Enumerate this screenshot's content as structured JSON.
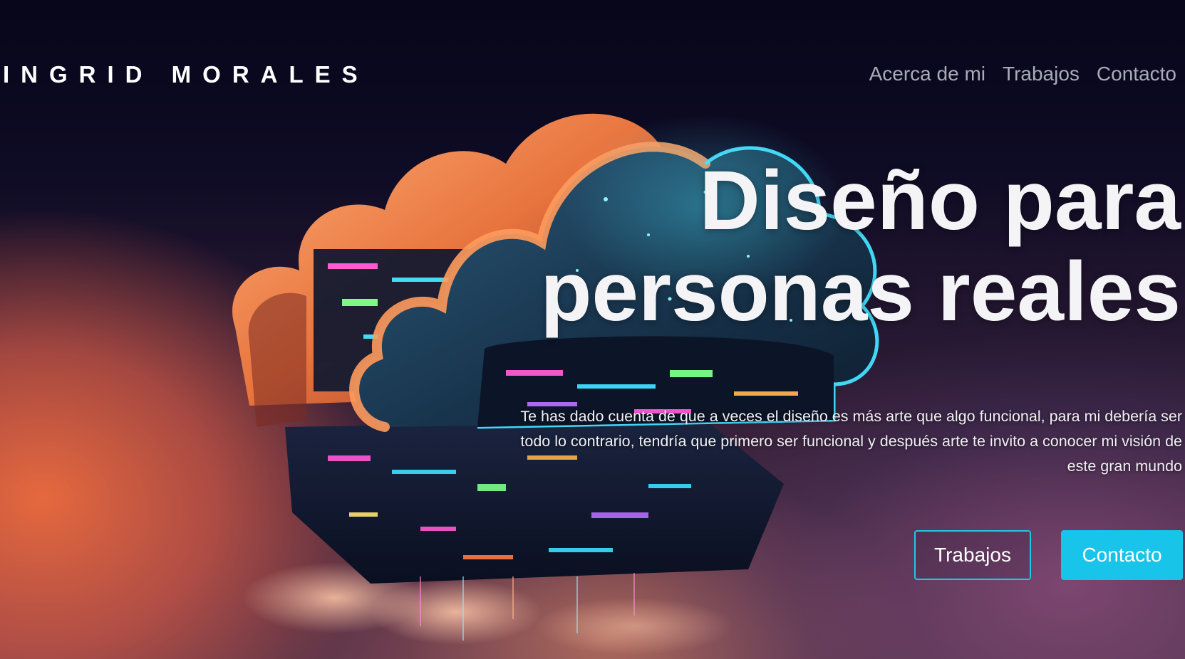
{
  "header": {
    "brand": "INGRID MORALES",
    "nav": [
      {
        "label": "Acerca de mi"
      },
      {
        "label": "Trabajos"
      },
      {
        "label": "Contacto"
      }
    ]
  },
  "hero": {
    "title_line1": "Diseño para",
    "title_line2": "personas reales",
    "description": "Te has dado cuenta de que a veces el diseño es más arte que algo funcional, para mi debería ser todo lo contrario, tendría que primero ser funcional y después arte te invito a conocer mi visión de este gran mundo",
    "buttons": {
      "secondary_label": "Trabajos",
      "primary_label": "Contacto"
    }
  },
  "colors": {
    "accent": "#19c4ea",
    "nav_text": "#a8acb8",
    "background_top": "#07061a",
    "warm_glow": "#ee6c3e"
  },
  "icons": {
    "hero_artwork": "floating-cloud-circuit-illustration"
  }
}
